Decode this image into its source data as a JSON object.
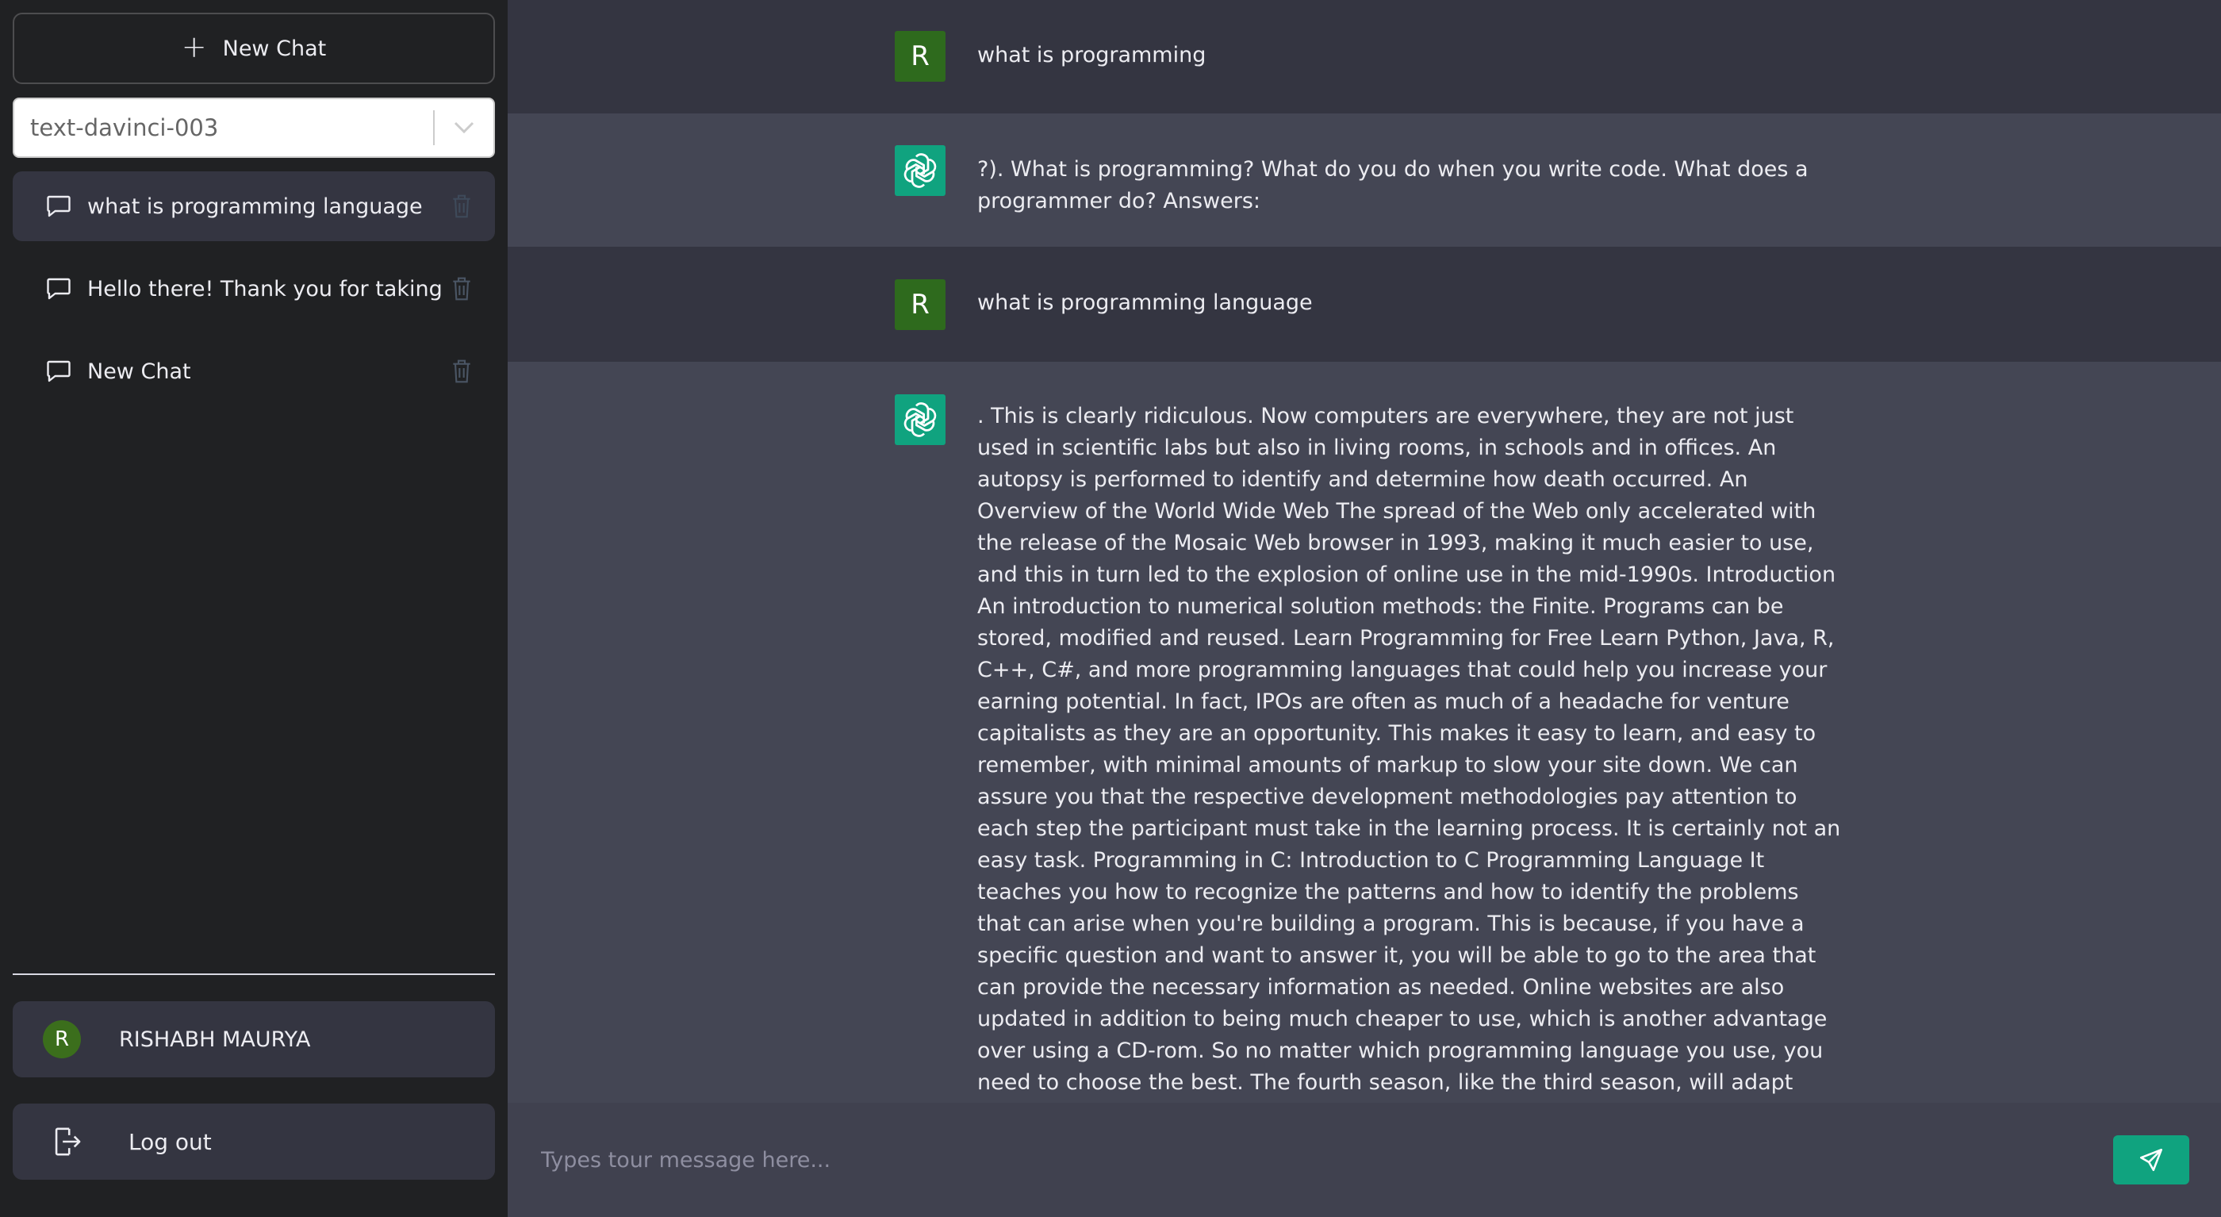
{
  "sidebar": {
    "new_chat_label": "New Chat",
    "model_select": {
      "value": "text-davinci-003"
    },
    "chats": [
      {
        "label": "what is programming language"
      },
      {
        "label": "Hello there! Thank you for taking"
      },
      {
        "label": "New Chat"
      }
    ],
    "user": {
      "avatar_initial": "R",
      "name": "RISHABH MAURYA"
    },
    "logout_label": "Log out"
  },
  "messages": [
    {
      "role": "user",
      "avatar": "R",
      "text": "what is programming"
    },
    {
      "role": "bot",
      "avatar": "chatgpt-logo-icon",
      "text": "?). What is programming? What do you do when you write code. What does a programmer do? Answers:"
    },
    {
      "role": "user",
      "avatar": "R",
      "text": "what is programming language"
    },
    {
      "role": "bot",
      "avatar": "chatgpt-logo-icon",
      "text": ". This is clearly ridiculous. Now computers are everywhere, they are not just used in scientific labs but also in living rooms, in schools and in offices. An autopsy is performed to identify and determine how death occurred. An Overview of the World Wide Web The spread of the Web only accelerated with the release of the Mosaic Web browser in 1993, making it much easier to use, and this in turn led to the explosion of online use in the mid-1990s. Introduction An introduction to numerical solution methods: the Finite. Programs can be stored, modified and reused. Learn Programming for Free Learn Python, Java, R, C++, C#, and more programming languages that could help you increase your earning potential. In fact, IPOs are often as much of a headache for venture capitalists as they are an opportunity. This makes it easy to learn, and easy to remember, with minimal amounts of markup to slow your site down. We can assure you that the respective development methodologies pay attention to each step the participant must take in the learning process. It is certainly not an easy task. Programming in C: Introduction to C Programming Language It teaches you how to recognize the patterns and how to identify the problems that can arise when you're building a program. This is because, if you have a specific question and want to answer it, you will be able to go to the area that can provide the necessary information as needed. Online websites are also updated in addition to being much cheaper to use, which is another advantage over using a CD-rom. So no matter which programming language you use, you need to choose the best. The fourth season, like the third season, will adapt three of the novels, A Feast for Crows, A Dance With Dragons and The Winds of Winter, which have not been released. They are not just words written on"
    }
  ],
  "composer": {
    "placeholder": "Types tour message here...",
    "send_icon": "send-icon"
  },
  "colors": {
    "sidebar_bg": "#202123",
    "main_bg": "#343541",
    "bot_row_bg": "#444654",
    "accent": "#10a37f",
    "user_avatar": "#2e6a1d"
  }
}
